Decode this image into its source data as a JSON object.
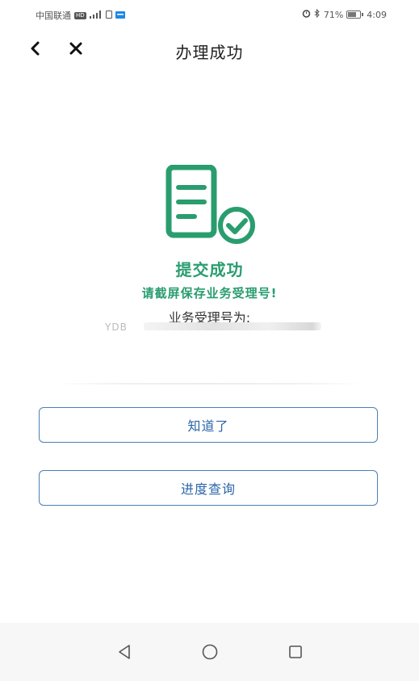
{
  "status_bar": {
    "carrier": "中国联通",
    "hd_badge": "HD",
    "network": "4G",
    "battery_percent": "71%",
    "battery_level": 0.71,
    "time": "4:09"
  },
  "header": {
    "title": "办理成功",
    "back_icon": "chevron-left-icon",
    "close_icon": "close-icon"
  },
  "result": {
    "icon": "document-check-icon",
    "icon_color": "#2a9d6f",
    "title": "提交成功",
    "hint": "请截屏保存业务受理号!",
    "receipt_label": "业务受理号为:",
    "receipt_prefix": "YDB"
  },
  "buttons": {
    "ok_label": "知道了",
    "progress_label": "进度查询",
    "accent_color": "#2b65a8"
  },
  "system_nav": {
    "back_icon": "triangle-back-icon",
    "home_icon": "circle-home-icon",
    "recent_icon": "square-recent-icon"
  }
}
